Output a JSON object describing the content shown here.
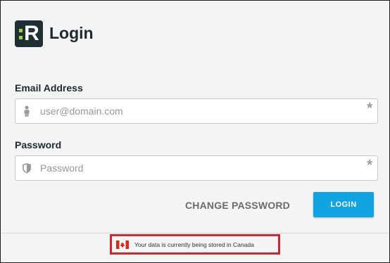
{
  "header": {
    "logo_letter": "R",
    "title": "Login"
  },
  "email": {
    "label": "Email Address",
    "placeholder": "user@domain.com",
    "required_marker": "*"
  },
  "password": {
    "label": "Password",
    "placeholder": "Password",
    "required_marker": "*"
  },
  "actions": {
    "change_password": "CHANGE PASSWORD",
    "login": "LOGIN"
  },
  "footer": {
    "storage_notice": "Your data is currently being stored in Canada"
  },
  "colors": {
    "brand_dark": "#1f3034",
    "brand_green": "#9ed04a",
    "login_button": "#12a4e2",
    "highlight_box": "#d6242e",
    "canada_red": "#d52b1e"
  },
  "icons": {
    "email": "person-icon",
    "password": "shield-icon",
    "flag": "canada-flag-icon"
  }
}
